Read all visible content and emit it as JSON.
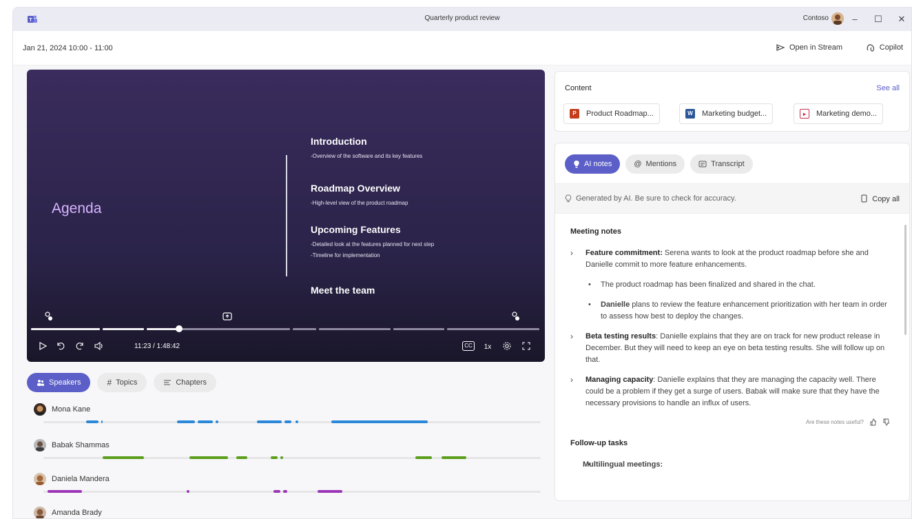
{
  "titlebar": {
    "title": "Quarterly product review",
    "tenant": "Contoso",
    "minimize": "–",
    "maximize": "☐",
    "close": "✕"
  },
  "meeting": {
    "datetime": "Jan 21, 2024 10:00 - 11:00",
    "open_in_stream": "Open in Stream",
    "copilot": "Copilot"
  },
  "video": {
    "agenda": "Agenda",
    "items": [
      {
        "heading": "Introduction",
        "details": [
          "-Overview of the software and its key features"
        ]
      },
      {
        "heading": "Roadmap Overview",
        "details": [
          "-High-level view of the product roadmap"
        ]
      },
      {
        "heading": "Upcoming Features",
        "details": [
          "-Detailed look at the features planned for next step",
          "-Timeline for implementation"
        ]
      },
      {
        "heading": "Meet the team",
        "details": []
      }
    ],
    "time": "11:23 / 1:48:42",
    "speed": "1x",
    "cc": "CC",
    "progress_fraction": 0.104
  },
  "speaker_tabs": {
    "speakers": "Speakers",
    "topics": "Topics",
    "chapters": "Chapters"
  },
  "speakers": [
    {
      "name": "Mona Kane",
      "color": "#2b88d8"
    },
    {
      "name": "Babak Shammas",
      "color": "#5a9e1a"
    },
    {
      "name": "Daniela Mandera",
      "color": "#9b36b7"
    },
    {
      "name": "Amanda Brady",
      "color": "#9b36b7"
    }
  ],
  "content": {
    "header": "Content",
    "see_all": "See all",
    "files": [
      {
        "name": "Product Roadmap...",
        "type": "P",
        "color": "#c43e1c"
      },
      {
        "name": "Marketing budget...",
        "type": "W",
        "color": "#2b579a"
      },
      {
        "name": "Marketing demo...",
        "type": "▸",
        "color": "#c4314b"
      }
    ]
  },
  "notes_tabs": {
    "ai_notes": "AI notes",
    "mentions": "Mentions",
    "transcript": "Transcript"
  },
  "notes": {
    "generated": "Generated by AI. Be sure to check for accuracy.",
    "copy_all": "Copy all",
    "meeting_notes": "Meeting notes",
    "n1_title": "Feature commitment:",
    "n1_text": " Serena wants to look at the product roadmap before she and Danielle commit to more feature enhancements.",
    "b1": "The product roadmap has been finalized and shared in the chat.",
    "b2_name": "Danielle",
    "b2_text": " plans to review the feature enhancement prioritization with her team in order to assess how best to deploy the changes.",
    "n2_title": "Beta testing results",
    "n2_text": ": Danielle explains that they are on track for new product release in December. But they will need to keep an eye on beta testing results. She will follow up on that.",
    "n3_title": "Managing capacity",
    "n3_text": ": Danielle explains that they are managing the capacity well. There could be a problem if they get a surge of users. Babak will make sure that they have the necessary provisions to handle an influx of users.",
    "useful": "Are these notes useful?",
    "followup": "Follow-up tasks",
    "f1": "Multilingual meetings:"
  }
}
